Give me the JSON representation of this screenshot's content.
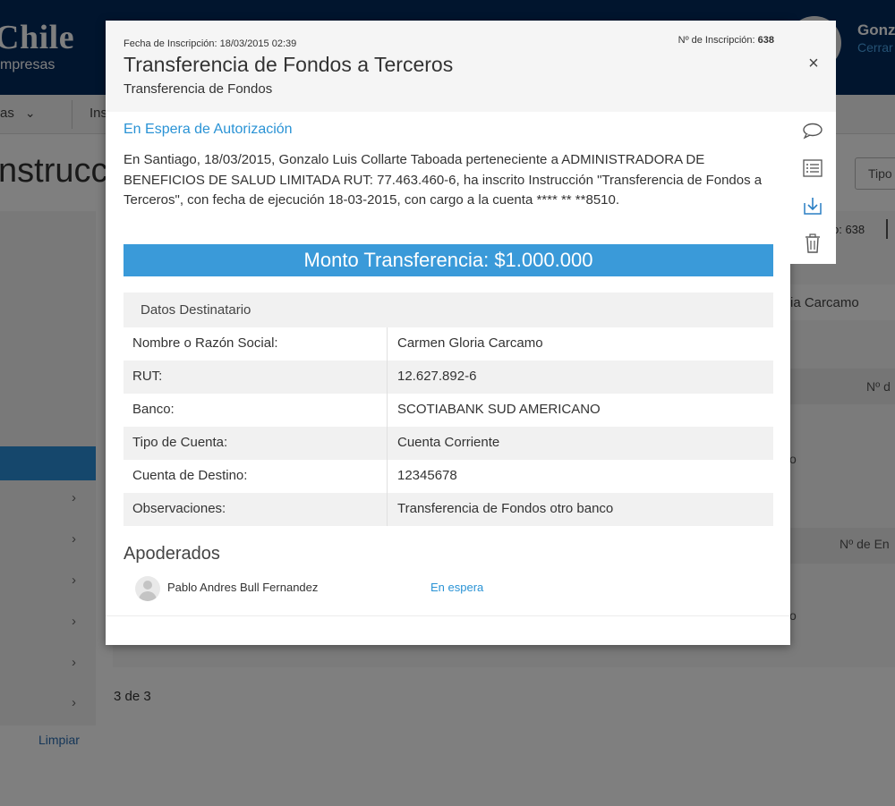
{
  "background": {
    "logo": "Chile",
    "logo_sub": "mpresas",
    "user_name": "Gonz",
    "close_session": "Cerrar",
    "nav_item_1": "as",
    "nav_item_2": "Ins",
    "page_title": "nstrucc",
    "filter_label": "Tipo",
    "inscription_label": "o: 638",
    "recipient": "ria Carcamo",
    "col_header_1": "Nº d",
    "col_header_2": "Nº de En",
    "cell_1": "o",
    "cell_2": "o",
    "pagination": "3 de 3",
    "clear": "Limpiar"
  },
  "modal": {
    "inscription_date": "Fecha de Inscripción: 18/03/2015 02:39",
    "inscription_number_label": "Nº de Inscripción:",
    "inscription_number": "638",
    "title": "Transferencia de Fondos a Terceros",
    "subtitle": "Transferencia de Fondos",
    "status": "En Espera de Autorización",
    "description": "En Santiago, 18/03/2015, Gonzalo Luis Collarte Taboada perteneciente a ADMINISTRADORA DE BENEFICIOS DE SALUD LIMITADA RUT: 77.463.460-6, ha inscrito Instrucción \"Transferencia de Fondos a Terceros\", con fecha de ejecución 18-03-2015, con cargo a la cuenta **** ** **8510.",
    "amount": "Monto Transferencia: $1.000.000",
    "recipient_section": "Datos Destinatario",
    "recipient_rows": [
      {
        "label": "Nombre o Razón Social:",
        "value": "Carmen Gloria Carcamo"
      },
      {
        "label": "RUT:",
        "value": "12.627.892-6"
      },
      {
        "label": "Banco:",
        "value": "SCOTIABANK SUD AMERICANO"
      },
      {
        "label": "Tipo de Cuenta:",
        "value": "Cuenta Corriente"
      },
      {
        "label": "Cuenta de Destino:",
        "value": "12345678"
      },
      {
        "label": "Observaciones:",
        "value": "Transferencia de Fondos otro banco"
      }
    ],
    "attorneys_title": "Apoderados",
    "attorneys": [
      {
        "name": "Pablo Andres Bull Fernandez",
        "status": "En espera"
      }
    ]
  },
  "toolbar": {
    "close_symbol": "×",
    "icons": [
      "comment-icon",
      "list-icon",
      "download-icon",
      "trash-icon"
    ]
  },
  "colors": {
    "header_navy": "#022a5c",
    "accent_blue": "#3a9ad9",
    "status_blue": "#2a93d5"
  }
}
